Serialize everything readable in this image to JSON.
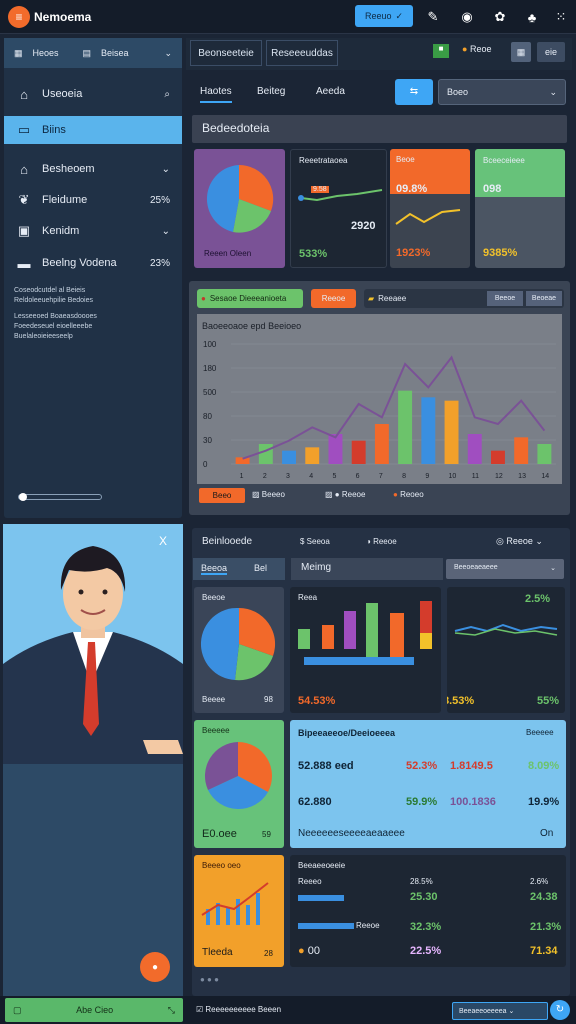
{
  "app": {
    "title": "Nemoema",
    "top_button": "Reeuo"
  },
  "sidebar": {
    "tabs": [
      "Heoes",
      "Beisea"
    ],
    "items": [
      {
        "label": "Useoeia",
        "icon": "home-icon",
        "right": "search-icon"
      },
      {
        "label": "Biins",
        "icon": "tablet-icon",
        "right": ""
      },
      {
        "label": "Besheoem",
        "icon": "house-icon",
        "right": "chevron-down-icon"
      },
      {
        "label": "Fleidume",
        "icon": "leaf-icon",
        "right": "25%"
      },
      {
        "label": "Kenidm",
        "icon": "calendar-icon",
        "right": "chevron-down-icon"
      },
      {
        "label": "Beelng Vodena",
        "icon": "file-icon",
        "right": "23%"
      }
    ],
    "notes": [
      "Coseodcutdel al Beieis",
      "Reldoleeuehpilie Bedoies",
      "Lesseeoed Boaeasdoooes",
      "Foeedeseuel eioelleeebe",
      "Buelaleoieieeseelp"
    ]
  },
  "top_tabs": [
    "Beonseeteie",
    "Reseeeuddas"
  ],
  "top_right": {
    "icon_label": "Reoe",
    "b2": "eie"
  },
  "filters": {
    "tabs": [
      "Haotes",
      "Beiteg",
      "Aeeda"
    ],
    "select": "Boeo"
  },
  "section1_title": "Bedeedoteia",
  "cards_top": [
    {
      "title": "Reeen Oleen",
      "value": "",
      "color": "#7a5296"
    },
    {
      "title": "Reeetrataoea",
      "label": "9.58",
      "value": "2920",
      "footer": "533%",
      "color": "#1d2633"
    },
    {
      "title": "Beoe",
      "value": "09.8%",
      "footer": "1923%",
      "color": "#f2692a"
    },
    {
      "title": "Bceeceieee",
      "value": "098",
      "footer": "9385%",
      "color": "#67c27a"
    }
  ],
  "chart1": {
    "legend": [
      "Sesaoe Dieeeanioeta",
      "Reeoe",
      "Reeaee"
    ],
    "buttons": [
      "Beeoe",
      "Beoeae"
    ],
    "title": "Baoeeoaoe epd Beeioeo",
    "yticks": [
      "100",
      "180",
      "500",
      "80",
      "30",
      "0"
    ],
    "bottom_legend": [
      "Beeo",
      "Beeeo",
      "Reeoe",
      "Reoeo"
    ]
  },
  "chart_data": {
    "type": "bar",
    "title": "Baoeeoaoe epd Beeioeo",
    "categories": [
      "1",
      "2",
      "3",
      "4",
      "5",
      "6",
      "7",
      "8",
      "9",
      "10",
      "11",
      "12",
      "13",
      "14"
    ],
    "series": [
      {
        "name": "Beeo",
        "values": [
          10,
          30,
          20,
          25,
          45,
          35,
          60,
          110,
          100,
          95,
          45,
          20,
          40,
          30
        ]
      },
      {
        "name": "Reeoe",
        "values": [
          8,
          20,
          35,
          55,
          40,
          90,
          70,
          150,
          115,
          160,
          70,
          60,
          95,
          50
        ]
      }
    ],
    "ylim": [
      0,
      180
    ]
  },
  "lower": {
    "header": [
      "Beinlooede",
      "Seeoa",
      "Reeoe"
    ],
    "subtabs": [
      "Beeoa",
      "Bel",
      "Meimg"
    ],
    "select": "Beeoeaeaeee"
  },
  "cards_mid": [
    {
      "title": "Beeoe",
      "footer": "Beeee",
      "value": "98"
    },
    {
      "title": "Reea",
      "value": "54.53%",
      "footer2": "8.53%"
    },
    {
      "title": "",
      "value": "2.5%",
      "footer": "55%"
    }
  ],
  "cards_low": [
    {
      "title": "Beeeee",
      "value": "E0.oee",
      "small": "59"
    },
    {
      "title": "Bipeeaeeoe/Deeioeeea",
      "right": "Beeeee",
      "rows": [
        [
          "52.888 eed",
          "52.3%",
          "1.8149.5",
          "8.09%"
        ],
        [
          "62.880",
          "59.9%",
          "100.1836",
          "19.9%"
        ]
      ],
      "footer": "Neeeeeeseeeeaeaaeee",
      "footer_right": "On"
    }
  ],
  "cards_bottom": [
    {
      "title": "Beeeo oeo",
      "value": "Tleeda",
      "small": "28"
    },
    {
      "title": "Beeaeeoeeie",
      "rows": [
        [
          "Reeeo",
          "28.5%",
          "2.6%"
        ],
        [
          "",
          "25.30",
          "24.38"
        ],
        [
          "Reeoe",
          "32.3%",
          "21.3%"
        ],
        [
          "00",
          "22.5%",
          "71.34"
        ]
      ]
    }
  ],
  "profile": {
    "close": "X"
  },
  "footer": {
    "button": "Abe Cieo",
    "status": "Reeeeeeeeee Beeen",
    "right_select": "Beeaeeoeeeea"
  }
}
